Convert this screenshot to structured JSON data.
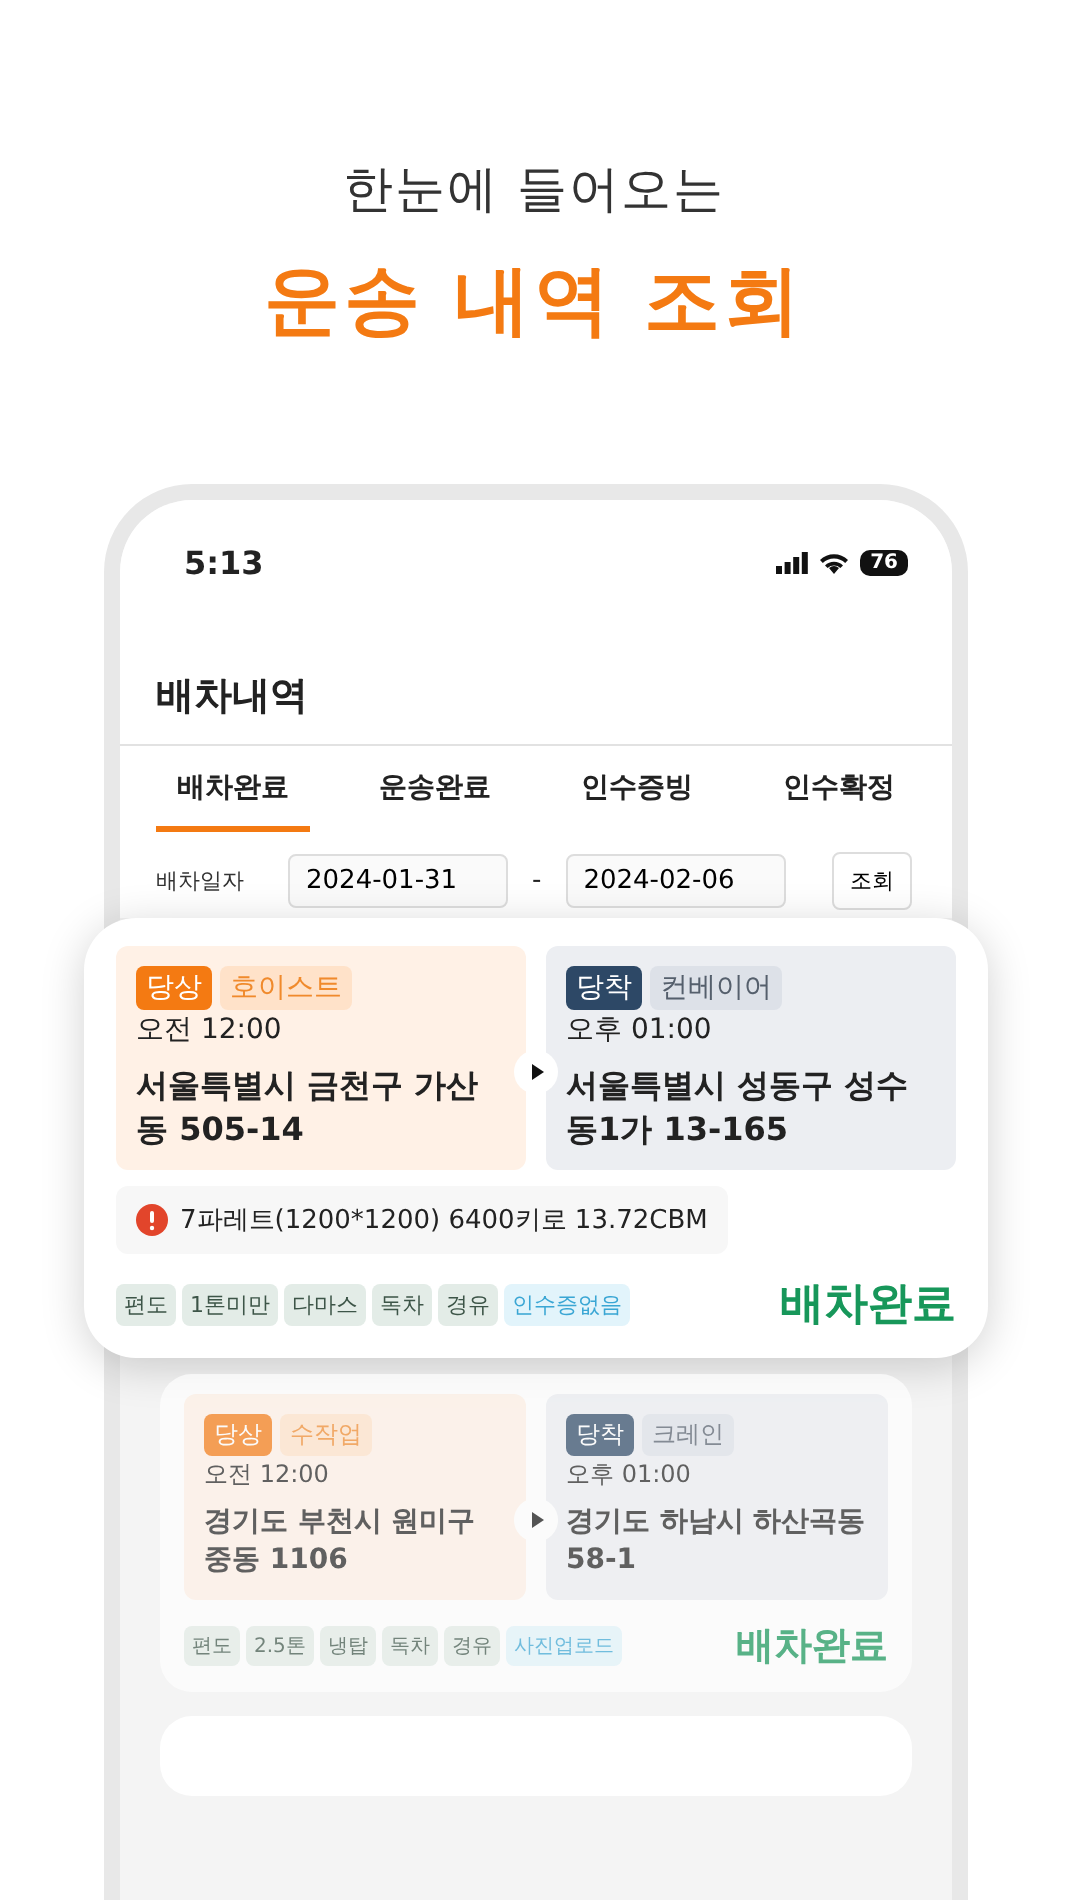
{
  "headline": {
    "subtitle": "한눈에 들어오는",
    "title": "운송 내역 조회"
  },
  "status_bar": {
    "time": "5:13",
    "battery": "76"
  },
  "page_title": "배차내역",
  "tabs": [
    {
      "label": "배차완료",
      "selected": true
    },
    {
      "label": "운송완료",
      "selected": false
    },
    {
      "label": "인수증빙",
      "selected": false
    },
    {
      "label": "인수확정",
      "selected": false
    }
  ],
  "filter": {
    "label": "배차일자",
    "start": "2024-01-31",
    "separator": "-",
    "end": "2024-02-06",
    "button": "조회"
  },
  "cards": [
    {
      "highlighted": true,
      "origin": {
        "badge": "당상",
        "method": "호이스트",
        "time": "오전 12:00",
        "address": "서울특별시 금천구 가산동 505-14"
      },
      "destination": {
        "badge": "당착",
        "method": "컨베이어",
        "time": "오후 01:00",
        "address": "서울특별시 성동구 성수동1가 13-165"
      },
      "cargo": "7파레트(1200*1200) 6400키로 13.72CBM",
      "tags": [
        {
          "label": "편도",
          "kind": "spec"
        },
        {
          "label": "1톤미만",
          "kind": "spec"
        },
        {
          "label": "다마스",
          "kind": "spec"
        },
        {
          "label": "독차",
          "kind": "spec"
        },
        {
          "label": "경유",
          "kind": "spec"
        },
        {
          "label": "인수증없음",
          "kind": "info"
        }
      ],
      "status": "배차완료"
    },
    {
      "highlighted": false,
      "origin": {
        "badge": "당상",
        "method": "수작업",
        "time": "오전 12:00",
        "address": "경기도 부천시 원미구 중동 1106"
      },
      "destination": {
        "badge": "당착",
        "method": "크레인",
        "time": "오후 01:00",
        "address": "경기도 하남시 하산곡동 58-1"
      },
      "tags": [
        {
          "label": "편도",
          "kind": "spec"
        },
        {
          "label": "2.5톤",
          "kind": "spec"
        },
        {
          "label": "냉탑",
          "kind": "spec"
        },
        {
          "label": "독차",
          "kind": "spec"
        },
        {
          "label": "경유",
          "kind": "spec"
        },
        {
          "label": "사진업로드",
          "kind": "info"
        }
      ],
      "status": "배차완료"
    }
  ]
}
